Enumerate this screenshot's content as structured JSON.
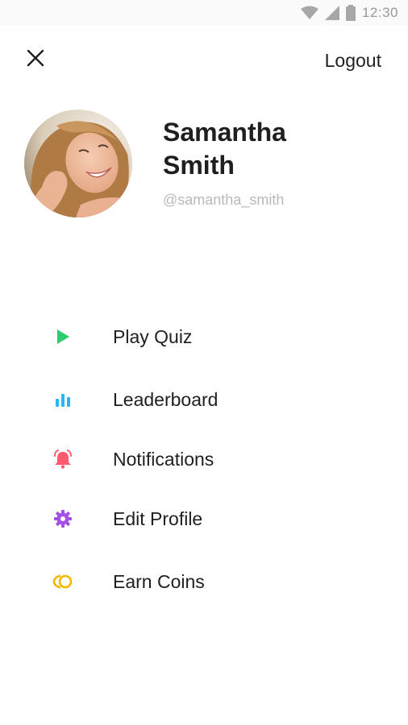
{
  "status_bar": {
    "time": "12:30",
    "icons": [
      "wifi-icon",
      "signal-icon",
      "battery-icon"
    ]
  },
  "header": {
    "close_icon": "close-icon",
    "logout_label": "Logout"
  },
  "profile": {
    "first_name": "Samantha",
    "last_name": "Smith",
    "handle": "@samantha_smith",
    "avatar": "user-photo"
  },
  "menu": {
    "items": [
      {
        "label": "Play Quiz",
        "icon": "play-icon",
        "color": "#2ecc71"
      },
      {
        "label": "Leaderboard",
        "icon": "bar-chart-icon",
        "color": "#29b6f6"
      },
      {
        "label": "Notifications",
        "icon": "bell-icon",
        "color": "#ff5a6e"
      },
      {
        "label": "Edit Profile",
        "icon": "gear-icon",
        "color": "#a64ee8"
      },
      {
        "label": "Earn Coins",
        "icon": "coins-icon",
        "color": "#f5b800"
      }
    ]
  }
}
